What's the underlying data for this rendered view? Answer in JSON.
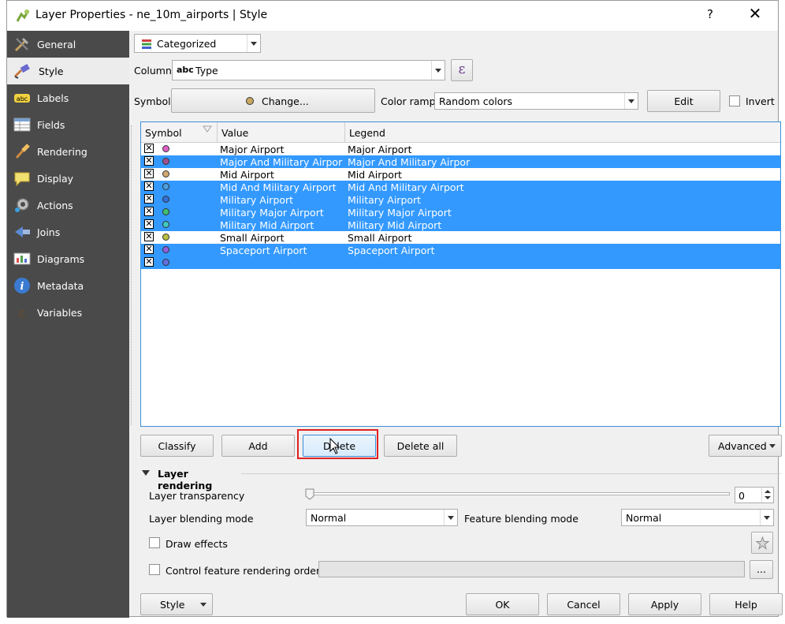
{
  "window": {
    "title": "Layer Properties - ne_10m_airports | Style",
    "help": "?",
    "close": "✕"
  },
  "sidebar": {
    "items": [
      {
        "label": "General",
        "icon": "tools-icon"
      },
      {
        "label": "Style",
        "icon": "paintbrush-icon",
        "active": true
      },
      {
        "label": "Labels",
        "icon": "abc-labels-icon"
      },
      {
        "label": "Fields",
        "icon": "table-fields-icon"
      },
      {
        "label": "Rendering",
        "icon": "brush-icon"
      },
      {
        "label": "Display",
        "icon": "speech-bubble-icon"
      },
      {
        "label": "Actions",
        "icon": "gear-actions-icon"
      },
      {
        "label": "Joins",
        "icon": "join-arrow-icon"
      },
      {
        "label": "Diagrams",
        "icon": "diagram-icon"
      },
      {
        "label": "Metadata",
        "icon": "info-icon"
      },
      {
        "label": "Variables",
        "icon": "epsilon-icon"
      }
    ]
  },
  "renderer": {
    "value": "Categorized"
  },
  "column": {
    "label": "Column",
    "type_badge": "abc",
    "value": "Type",
    "expr_button": "ε"
  },
  "symbol": {
    "label": "Symbol",
    "change_button": "Change..."
  },
  "color_ramp": {
    "label": "Color ramp",
    "value": "Random colors",
    "edit_button": "Edit",
    "invert_label": "Invert"
  },
  "table": {
    "headers": {
      "symbol": "Symbol",
      "value": "Value",
      "legend": "Legend"
    },
    "rows": [
      {
        "value": "Major Airport",
        "legend": "Major Airport",
        "color": "#e060c8",
        "selected": false
      },
      {
        "value": "Major And Military Airpor",
        "legend": "Major And Military Airpor",
        "color": "#a05090",
        "selected": true
      },
      {
        "value": "Mid Airport",
        "legend": "Mid Airport",
        "color": "#d0a870",
        "selected": false
      },
      {
        "value": "Mid And Military Airport",
        "legend": "Mid And Military Airport",
        "color": "#4aa0e0",
        "selected": true
      },
      {
        "value": "Military Airport",
        "legend": "Military Airport",
        "color": "#3070d8",
        "selected": true
      },
      {
        "value": "Military Major Airport",
        "legend": "Military Major Airport",
        "color": "#40c070",
        "selected": true
      },
      {
        "value": "Military Mid Airport",
        "legend": "Military Mid Airport",
        "color": "#40c8c0",
        "selected": true
      },
      {
        "value": "Small Airport",
        "legend": "Small Airport",
        "color": "#b8c040",
        "selected": false
      },
      {
        "value": "Spaceport Airport",
        "legend": "Spaceport Airport",
        "color": "#9060e0",
        "selected": true
      },
      {
        "value": "",
        "legend": "",
        "color": "#6070e0",
        "selected": true
      }
    ]
  },
  "buttons": {
    "classify": "Classify",
    "add": "Add",
    "delete": "Delete",
    "delete_all": "Delete all",
    "advanced": "Advanced"
  },
  "layer_rendering": {
    "section_title": "Layer rendering",
    "transparency_label": "Layer transparency",
    "transparency_value": "0",
    "blending_label": "Layer blending mode",
    "blending_value": "Normal",
    "feature_blending_label": "Feature blending mode",
    "feature_blending_value": "Normal",
    "draw_effects_label": "Draw effects",
    "control_order_label": "Control feature rendering order",
    "order_button": "..."
  },
  "footer": {
    "style": "Style",
    "ok": "OK",
    "cancel": "Cancel",
    "apply": "Apply",
    "help": "Help"
  }
}
